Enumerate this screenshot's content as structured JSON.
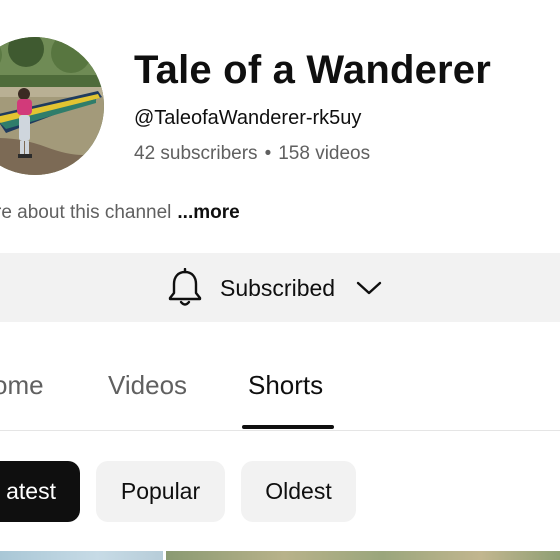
{
  "channel": {
    "name": "Tale of a Wanderer",
    "handle": "@TaleofaWanderer-rk5uy",
    "subscribers": "42 subscribers",
    "separator": "•",
    "videos": "158 videos",
    "description": "re about this channel",
    "more_label": "...more",
    "avatar_icon": "channel-avatar"
  },
  "subscribe": {
    "label": "Subscribed",
    "bell_icon": "bell-icon",
    "chevron_icon": "chevron-down-icon"
  },
  "tabs": [
    {
      "label": "ome",
      "active": false
    },
    {
      "label": "Videos",
      "active": false
    },
    {
      "label": "Shorts",
      "active": true
    }
  ],
  "chips": [
    {
      "label": "atest",
      "selected": true
    },
    {
      "label": "Popular",
      "selected": false
    },
    {
      "label": "Oldest",
      "selected": false
    }
  ],
  "colors": {
    "text_primary": "#0f0f0f",
    "text_secondary": "#606060",
    "chip_background": "#f2f2f2",
    "selected_chip": "#0f0f0f"
  }
}
